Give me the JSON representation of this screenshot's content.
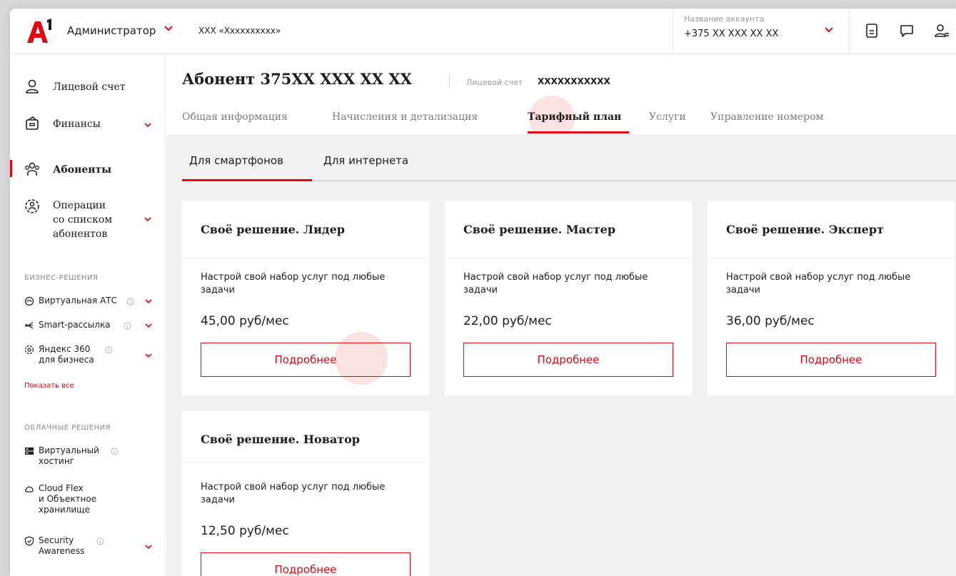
{
  "topbar": {
    "role": "Администратор",
    "company": "ХХХ «Хххххххххх»",
    "account_label": "Название аккаунта",
    "account_number": "+375 XX XXX XX XX",
    "icons": [
      "document-icon",
      "chat-icon",
      "user-menu-icon"
    ]
  },
  "sidebar": {
    "items": [
      {
        "label": "Лицевой счет",
        "icon": "user-icon"
      },
      {
        "label": "Финансы",
        "icon": "wallet-icon"
      },
      {
        "label": "Абоненты",
        "icon": "subscribers-icon",
        "active": true
      },
      {
        "label": "Операции\nсо списком\nабонентов",
        "icon": "operations-icon"
      }
    ],
    "business_header": "БИЗНЕС-РЕШЕНИЯ",
    "business_items": [
      {
        "label": "Виртуальная АТС",
        "icon": "pbx-icon"
      },
      {
        "label": "Smart-рассылка",
        "icon": "broadcast-icon"
      },
      {
        "label": "Яндекс 360\nдля бизнеса",
        "icon": "yandex-icon"
      }
    ],
    "show_all": "Показать все",
    "cloud_header": "ОБЛАЧНЫЕ РЕШЕНИЯ",
    "cloud_items": [
      {
        "label": "Виртуальный\nхостинг",
        "icon": "server-icon"
      },
      {
        "label": "Cloud Flex\nи Объектное\nхранилище",
        "icon": "cloud-icon"
      },
      {
        "label": "Security\nAwareness",
        "icon": "shield-icon"
      }
    ]
  },
  "main": {
    "subscriber_title": "Абонент 375XX XXX XX XX",
    "account_label": "Лицевой счет",
    "account_value": "XXXXXXXXXXX",
    "tabs": [
      "Общая информация",
      "Начисления и детализация",
      "Тарифный план",
      "Услуги",
      "Управление номером"
    ],
    "active_tab": "Тарифный план",
    "subtabs": [
      "Для смартфонов",
      "Для интернета"
    ],
    "active_subtab": "Для смартфонов"
  },
  "plans": [
    {
      "title": "Своё решение. Лидер",
      "description": "Настрой свой набор услуг под любые задачи",
      "price": "45,00 руб/мес",
      "button": "Подробнее"
    },
    {
      "title": "Своё решение. Мастер",
      "description": "Настрой свой набор услуг под любые задачи",
      "price": "22,00 руб/мес",
      "button": "Подробнее"
    },
    {
      "title": "Своё решение. Эксперт",
      "description": "Настрой свой набор услуг под любые задачи",
      "price": "36,00 руб/мес",
      "button": "Подробнее"
    },
    {
      "title": "Своё решение. Новатор",
      "description": "Настрой свой набор услуг под любые задачи",
      "price": "12,50 руб/мес",
      "button": "Подробнее"
    }
  ],
  "colors": {
    "accent": "#e30613",
    "content_bg": "#f2f2f2",
    "card_bg": "#ffffff"
  }
}
